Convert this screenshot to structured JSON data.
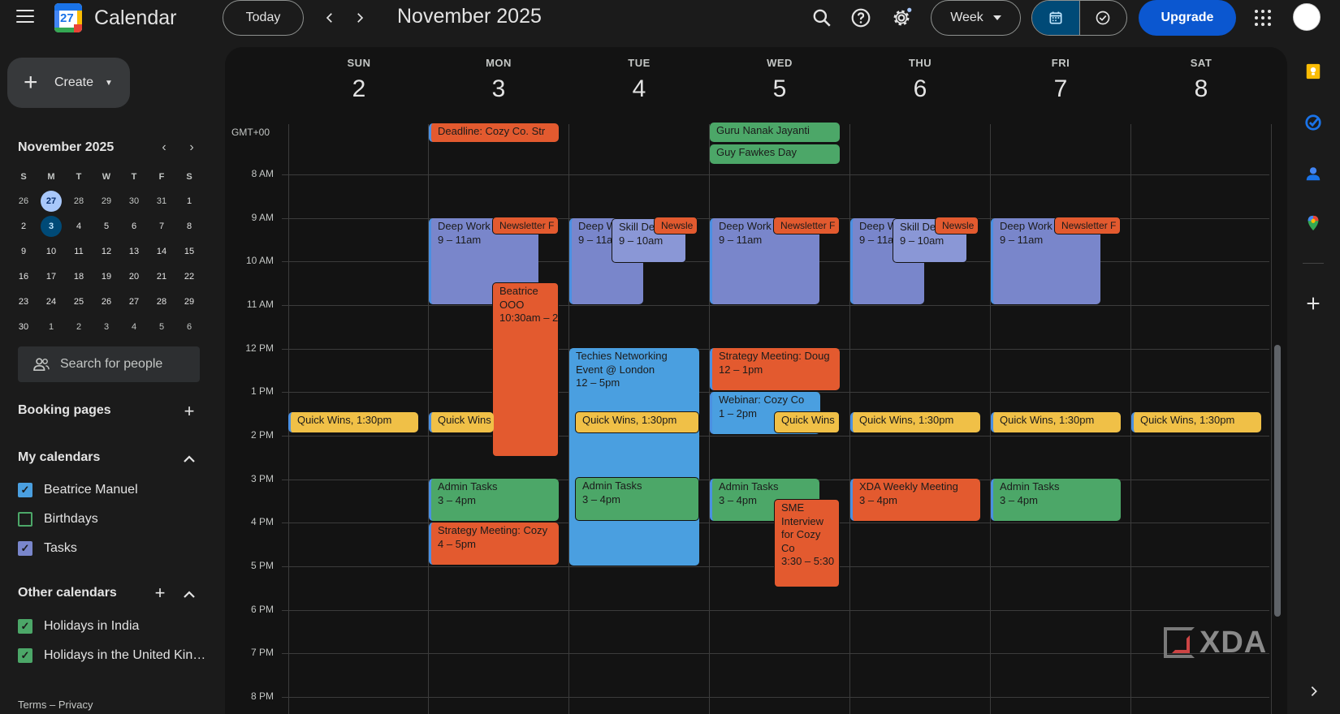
{
  "header": {
    "app_title": "Calendar",
    "logo_date": "27",
    "today_label": "Today",
    "month_title": "November 2025",
    "view_label": "Week",
    "upgrade_label": "Upgrade"
  },
  "sidebar": {
    "create_label": "Create",
    "mini_title": "November 2025",
    "weekday_heads": [
      "S",
      "M",
      "T",
      "W",
      "T",
      "F",
      "S"
    ],
    "days": [
      "26",
      "27",
      "28",
      "29",
      "30",
      "31",
      "1",
      "2",
      "3",
      "4",
      "5",
      "6",
      "7",
      "8",
      "9",
      "10",
      "11",
      "12",
      "13",
      "14",
      "15",
      "16",
      "17",
      "18",
      "19",
      "20",
      "21",
      "22",
      "23",
      "24",
      "25",
      "26",
      "27",
      "28",
      "29",
      "30",
      "1",
      "2",
      "3",
      "4",
      "5",
      "6"
    ],
    "search_people": "Search for people",
    "booking_pages": "Booking pages",
    "my_calendars_title": "My calendars",
    "my_calendars": [
      {
        "label": "Beatrice Manuel",
        "color": "#4a9fe0",
        "checked": true
      },
      {
        "label": "Birthdays",
        "color": "#4ca768",
        "checked": false
      },
      {
        "label": "Tasks",
        "color": "#7986cb",
        "checked": true
      }
    ],
    "other_calendars_title": "Other calendars",
    "other_calendars": [
      {
        "label": "Holidays in India",
        "color": "#4ca768",
        "checked": true
      },
      {
        "label": "Holidays in the United Kin…",
        "color": "#4ca768",
        "checked": true
      }
    ],
    "footer": "Terms – Privacy"
  },
  "week": {
    "days": [
      {
        "name": "SUN",
        "num": "2"
      },
      {
        "name": "MON",
        "num": "3"
      },
      {
        "name": "TUE",
        "num": "4"
      },
      {
        "name": "WED",
        "num": "5"
      },
      {
        "name": "THU",
        "num": "6"
      },
      {
        "name": "FRI",
        "num": "7"
      },
      {
        "name": "SAT",
        "num": "8"
      }
    ],
    "timezone": "GMT+00",
    "hours": [
      "8 AM",
      "9 AM",
      "10 AM",
      "11 AM",
      "12 PM",
      "1 PM",
      "2 PM",
      "3 PM",
      "4 PM",
      "5 PM",
      "6 PM",
      "7 PM",
      "8 PM"
    ]
  },
  "events": {
    "deadline": "Deadline: Cozy Co. Str",
    "guru": "Guru Nanak Jayanti",
    "guy": "Guy Fawkes Day",
    "deep_work": "Deep Work",
    "deep_w": "Deep W",
    "deep_time": "9 – 11am",
    "deep_time_short": "9 – 11an",
    "newsletter": "Newsletter F",
    "newsletter_short": "Newsle",
    "skill": "Skill De",
    "skill_time": "9 – 10am",
    "beatrice": "Beatrice OOO",
    "beatrice_time": "10:30am – 2",
    "techies": "Techies Networking Event @ London",
    "techies_time": "12 – 5pm",
    "strategy_doug": "Strategy Meeting: Doug",
    "strategy_doug_time": "12 – 1pm",
    "webinar": "Webinar: Cozy Co",
    "webinar_time": "1 – 2pm",
    "quick_wins": "Quick Wins",
    "quick_wins_sep": ", ",
    "quick_time": "1:30pm",
    "admin": "Admin Tasks",
    "admin_time": "3 – 4pm",
    "strategy_cozy": "Strategy Meeting: Cozy",
    "strategy_cozy_time": "4 – 5pm",
    "sme": "SME Interview for Cozy Co",
    "sme_time": "3:30 – 5:30",
    "xda": "XDA Weekly Meeting",
    "xda_time": "3 – 4pm"
  },
  "watermark": "XDA"
}
